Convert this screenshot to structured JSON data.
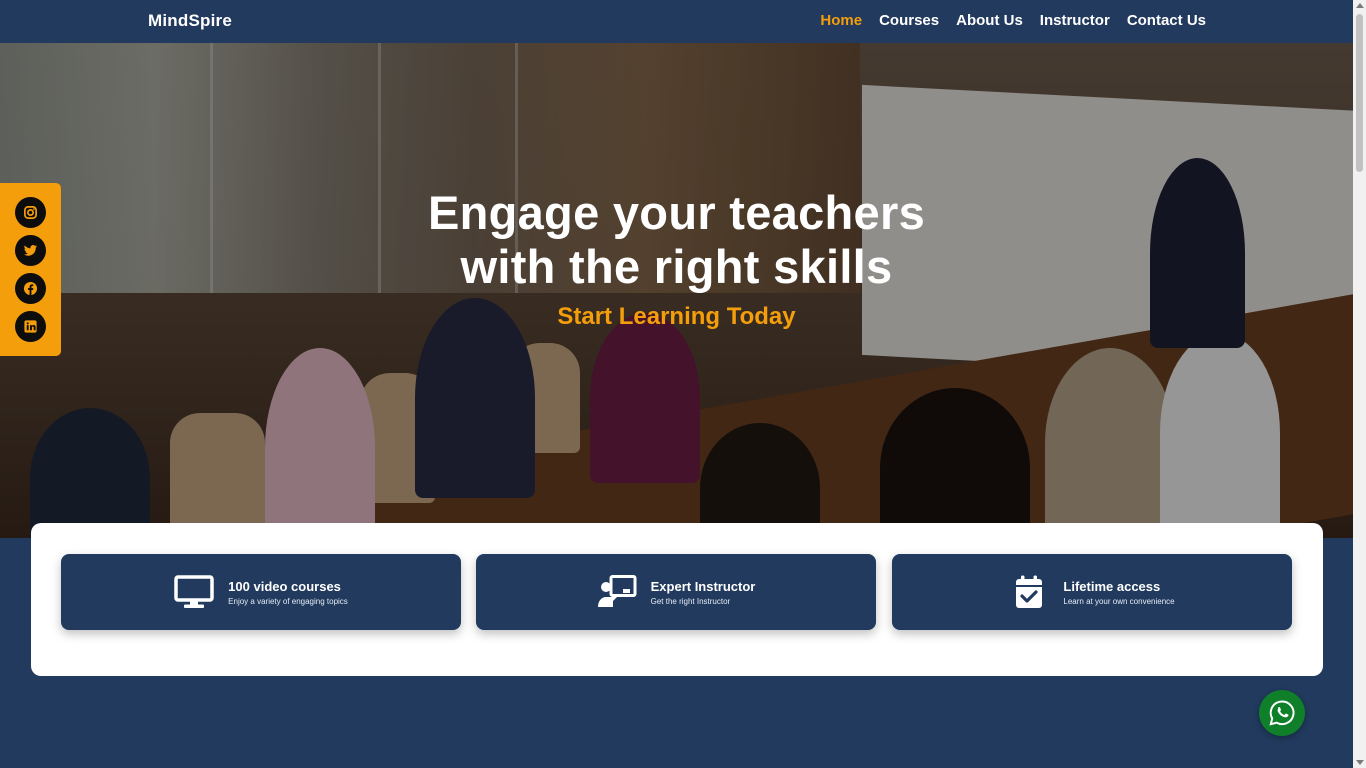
{
  "brand": "MindSpire",
  "nav": {
    "items": [
      {
        "label": "Home",
        "active": true
      },
      {
        "label": "Courses",
        "active": false
      },
      {
        "label": "About Us",
        "active": false
      },
      {
        "label": "Instructor",
        "active": false
      },
      {
        "label": "Contact Us",
        "active": false
      }
    ]
  },
  "hero": {
    "title_line1": "Engage your teachers",
    "title_line2": "with the right skills",
    "subtitle": "Start Learning Today"
  },
  "social": {
    "icons": [
      "instagram-icon",
      "twitter-icon",
      "facebook-icon",
      "linkedin-icon"
    ]
  },
  "features": [
    {
      "icon": "monitor-icon",
      "title": "100 video courses",
      "subtitle": "Enjoy a variety of engaging topics"
    },
    {
      "icon": "instructor-icon",
      "title": "Expert Instructor",
      "subtitle": "Get the right Instructor"
    },
    {
      "icon": "calendar-check-icon",
      "title": "Lifetime access",
      "subtitle": "Learn at your own convenience"
    }
  ],
  "colors": {
    "primary": "#213a5d",
    "accent": "#f59e0b",
    "whatsapp": "#0f7f2a",
    "white": "#ffffff"
  }
}
